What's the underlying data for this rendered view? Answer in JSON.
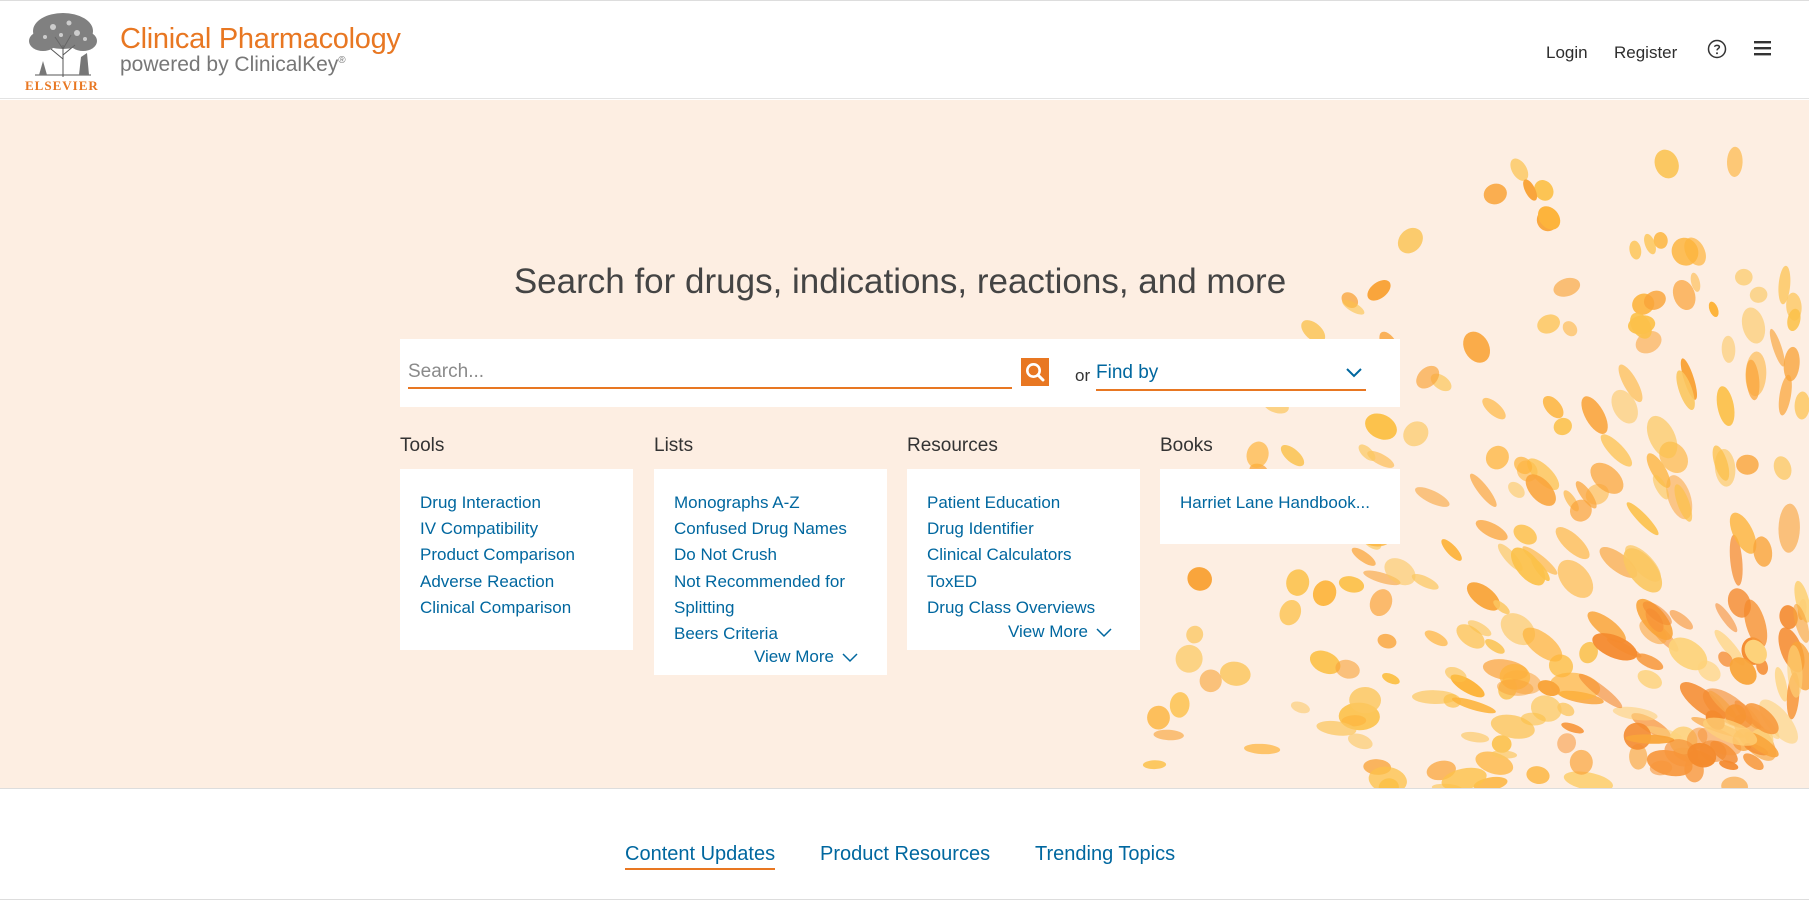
{
  "header": {
    "publisher": "ELSEVIER",
    "brand_title": "Clinical Pharmacology",
    "brand_subtitle": "powered by ClinicalKey",
    "brand_mark": "®",
    "login_label": "Login",
    "register_label": "Register",
    "help_icon": "help-circle-icon",
    "menu_icon": "hamburger-menu-icon"
  },
  "hero": {
    "heading": "Search for drugs, indications, reactions, and more",
    "search_placeholder": "Search...",
    "search_icon": "magnifier-icon",
    "or_label": "or",
    "findby_label": "Find by"
  },
  "sections": {
    "tools": {
      "title": "Tools",
      "items": [
        "Drug Interaction",
        "IV Compatibility",
        "Product Comparison",
        "Adverse Reaction",
        "Clinical Comparison"
      ]
    },
    "lists": {
      "title": "Lists",
      "items": [
        "Monographs A-Z",
        "Confused Drug Names",
        "Do Not Crush",
        "Not Recommended for",
        "Splitting",
        "Beers Criteria"
      ],
      "view_more": "View More"
    },
    "resources": {
      "title": "Resources",
      "items": [
        "Patient Education",
        "Drug Identifier",
        "Clinical Calculators",
        "ToxED",
        "Drug Class Overviews"
      ],
      "view_more": "View More"
    },
    "books": {
      "title": "Books",
      "items": [
        "Harriet Lane Handbook..."
      ]
    }
  },
  "tabs": {
    "content_updates": "Content Updates",
    "product_resources": "Product Resources",
    "trending_topics": "Trending Topics",
    "active": "Content Updates"
  },
  "colors": {
    "brand_orange": "#e87722",
    "link_blue": "#00679f",
    "hero_bg": "#fdeee2"
  }
}
